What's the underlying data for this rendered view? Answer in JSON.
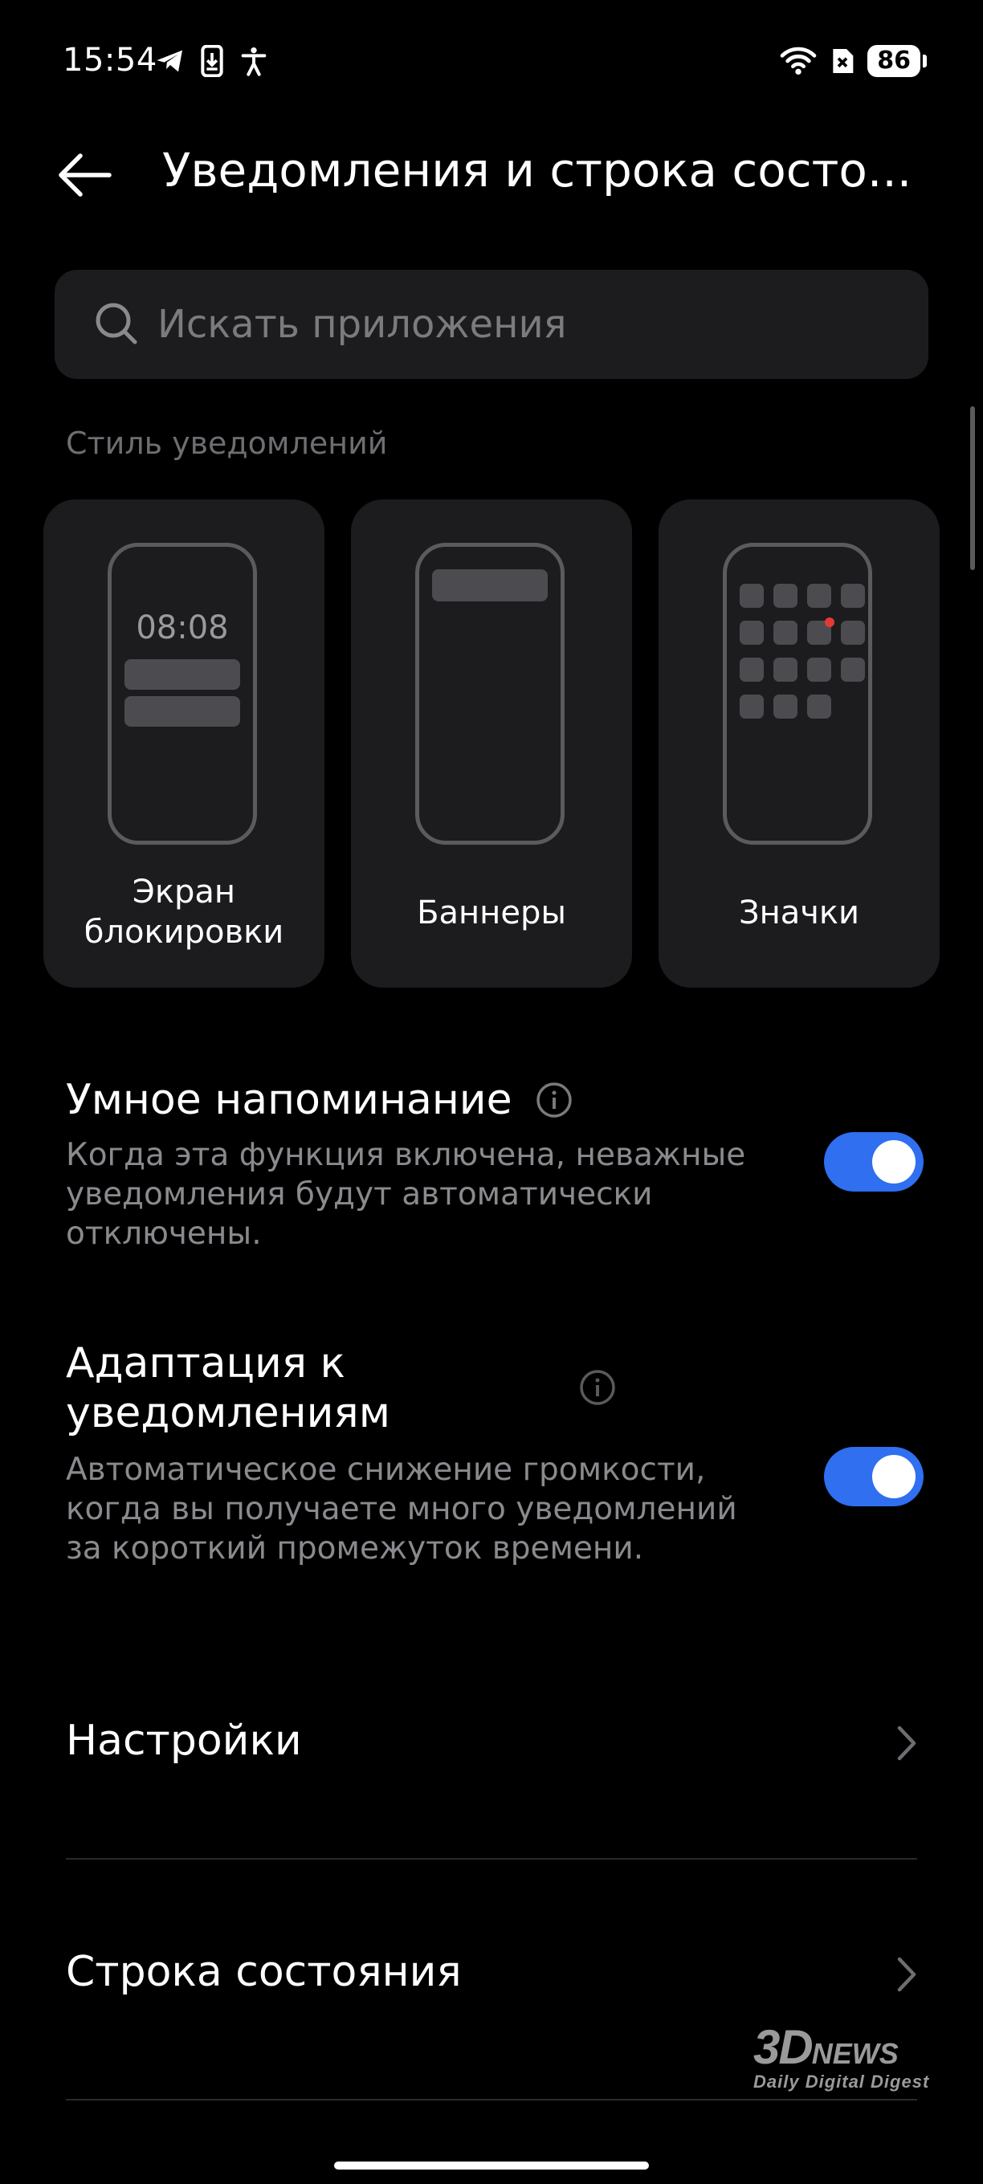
{
  "status_bar": {
    "time": "15:54",
    "battery": "86",
    "left_icons": [
      "telegram-icon",
      "download-phone-icon",
      "accessibility-icon"
    ],
    "right_icons": [
      "wifi-icon",
      "no-sim-icon",
      "battery-icon"
    ]
  },
  "header": {
    "title": "Уведомления и строка состо..."
  },
  "search": {
    "placeholder": "Искать приложения"
  },
  "notification_style": {
    "section_label": "Стиль уведомлений",
    "cards": [
      {
        "label": "Экран\nблокировки",
        "preview_time": "08:08"
      },
      {
        "label": "Баннеры"
      },
      {
        "label": "Значки"
      }
    ]
  },
  "smart_reminder": {
    "title": "Умное напоминание",
    "description": "Когда эта функция включена, неважные уведомления будут автоматически отключены.",
    "enabled": true
  },
  "notification_adaptation": {
    "title_line1": "Адаптация к",
    "title_line2": "уведомлениям",
    "description": "Автоматическое снижение громкости, когда вы получаете много уведомлений за короткий промежуток времени.",
    "enabled": true
  },
  "nav_items": {
    "settings": "Настройки",
    "status_bar": "Строка состояния"
  },
  "watermark": {
    "main": "3D",
    "news": "NEWS",
    "tagline": "Daily Digital Digest"
  },
  "colors": {
    "background": "#000000",
    "card": "#1c1c1e",
    "toggle_on": "#2f6ff0",
    "secondary_text": "#8a8a8e"
  }
}
